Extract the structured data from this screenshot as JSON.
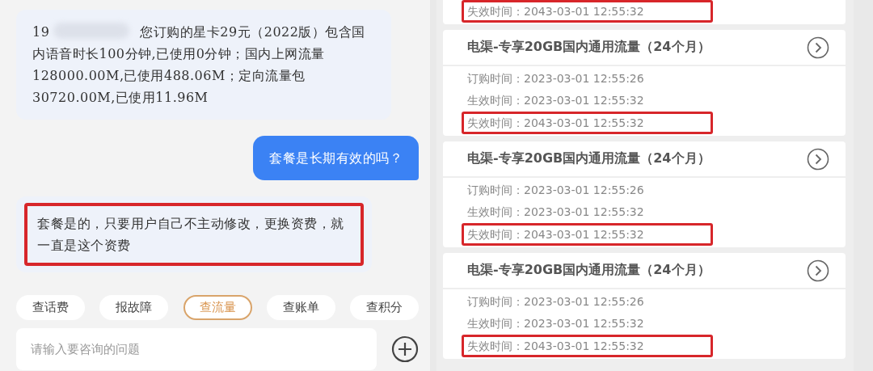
{
  "chat": {
    "messages": [
      {
        "kind": "received",
        "prefix": "19",
        "redacted": true,
        "text": "您订购的星卡29元（2022版）包含国内语音时长100分钟,已使用0分钟；国内上网流量128000.00M,已使用488.06M；定向流量包30720.00M,已使用11.96M",
        "highlighted": false
      },
      {
        "kind": "sent",
        "text": "套餐是长期有效的吗？",
        "highlighted": false
      },
      {
        "kind": "received",
        "text": "套餐是的，只要用户自己不主动修改，更换资费，就一直是这个资费",
        "highlighted": true
      }
    ],
    "quick_replies": [
      {
        "label": "查话费",
        "selected": false
      },
      {
        "label": "报故障",
        "selected": false
      },
      {
        "label": "查流量",
        "selected": true
      },
      {
        "label": "查账单",
        "selected": false
      },
      {
        "label": "查积分",
        "selected": false
      }
    ],
    "input": {
      "placeholder": "请输入要咨询的问题"
    }
  },
  "orders": [
    {
      "fields": [
        {
          "text": "失效时间：2043-03-01 12:55:32",
          "highlighted": true
        }
      ]
    },
    {
      "title": "电渠-专享20GB国内通用流量（24个月）",
      "fields": [
        {
          "text": "订购时间：2023-03-01 12:55:26",
          "highlighted": false
        },
        {
          "text": "生效时间：2023-03-01 12:55:32",
          "highlighted": false
        },
        {
          "text": "失效时间：2043-03-01 12:55:32",
          "highlighted": true
        }
      ]
    },
    {
      "title": "电渠-专享20GB国内通用流量（24个月）",
      "fields": [
        {
          "text": "订购时间：2023-03-01 12:55:26",
          "highlighted": false
        },
        {
          "text": "生效时间：2023-03-01 12:55:32",
          "highlighted": false
        },
        {
          "text": "失效时间：2043-03-01 12:55:32",
          "highlighted": true
        }
      ]
    },
    {
      "title": "电渠-专享20GB国内通用流量（24个月）",
      "fields": [
        {
          "text": "订购时间：2023-03-01 12:55:26",
          "highlighted": false
        },
        {
          "text": "生效时间：2023-03-01 12:55:32",
          "highlighted": false
        },
        {
          "text": "失效时间：2043-03-01 12:55:32",
          "highlighted": true
        }
      ]
    }
  ]
}
